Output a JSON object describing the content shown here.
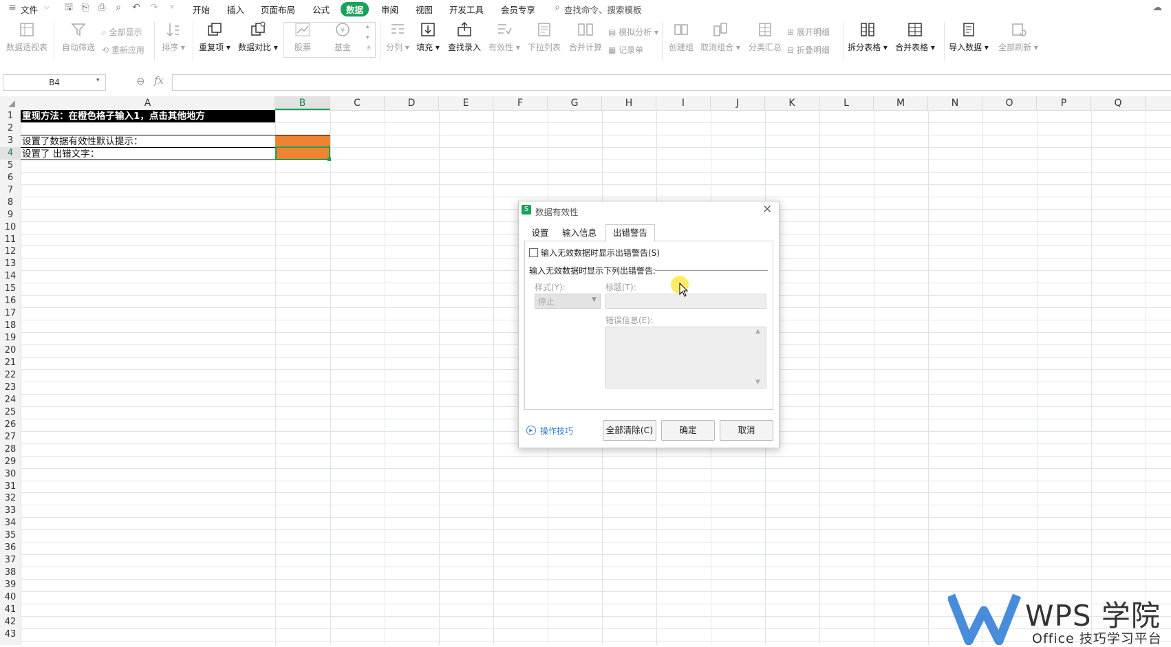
{
  "menubar": {
    "file_label": "文件",
    "tabs": [
      "开始",
      "插入",
      "页面布局",
      "公式",
      "数据",
      "审阅",
      "视图",
      "开发工具",
      "会员专享"
    ],
    "active_tab": "数据",
    "search_placeholder": "查找命令、搜索模板"
  },
  "ribbon": {
    "pivot": "数据透视表",
    "autofilter": "自动筛选",
    "show_all": "全部显示",
    "reapply": "重新应用",
    "sort": "排序",
    "duplicates": "重复项",
    "compare": "数据对比",
    "stocks": "股票",
    "funds": "基金",
    "split": "分列",
    "fill": "填充",
    "lookup": "查找录入",
    "validity": "有效性",
    "dropdown": "下拉列表",
    "consolidate": "合并计算",
    "simulate": "模拟分析",
    "record": "记录单",
    "group": "创建组",
    "ungroup": "取消组合",
    "subtotal": "分类汇总",
    "expand": "展开明细",
    "collapse": "折叠明细",
    "split_table": "拆分表格",
    "merge_table": "合并表格",
    "import": "导入数据",
    "refresh_all": "全部刷新"
  },
  "formula_bar": {
    "cell_ref": "B4",
    "fx": "fx",
    "content": ""
  },
  "sheet": {
    "columns": [
      "A",
      "B",
      "C",
      "D",
      "E",
      "F",
      "G",
      "H",
      "I",
      "J",
      "K",
      "L",
      "M",
      "N",
      "O",
      "P",
      "Q"
    ],
    "selected_column": "B",
    "rows": [
      "1",
      "2",
      "3",
      "4",
      "5",
      "6",
      "7",
      "8",
      "9",
      "10",
      "11",
      "12",
      "13",
      "14",
      "15",
      "16",
      "17",
      "18",
      "19",
      "20",
      "21",
      "22",
      "23",
      "24",
      "25",
      "26",
      "27",
      "28",
      "29",
      "30",
      "31",
      "32",
      "33",
      "34",
      "35",
      "36",
      "37",
      "38",
      "39",
      "40",
      "41",
      "42",
      "43"
    ],
    "selected_row": "4",
    "a1": "重现方法：在橙色格子输入1，点击其他地方",
    "a3": "设置了数据有效性默认提示：",
    "a4": "设置了 出错文字：",
    "highlight_color": "#ef8332"
  },
  "dialog": {
    "title": "数据有效性",
    "tabs": [
      "设置",
      "输入信息",
      "出错警告"
    ],
    "active_tab": "出错警告",
    "checkbox_label": "输入无效数据时显示出错警告(S)",
    "checked": false,
    "section_label": "输入无效数据时显示下列出错警告:",
    "style_label": "样式(Y):",
    "style_value": "停止",
    "title_label": "标题(T):",
    "title_value": "",
    "error_label": "错误信息(E):",
    "error_value": "",
    "tips_link": "操作技巧",
    "clear_all": "全部清除(C)",
    "ok": "确定",
    "cancel": "取消"
  },
  "watermark": {
    "logo": "WPS 学院",
    "tagline": "Office 技巧学习平台"
  },
  "colors": {
    "accent": "#1aa159",
    "orange": "#ef8332"
  }
}
